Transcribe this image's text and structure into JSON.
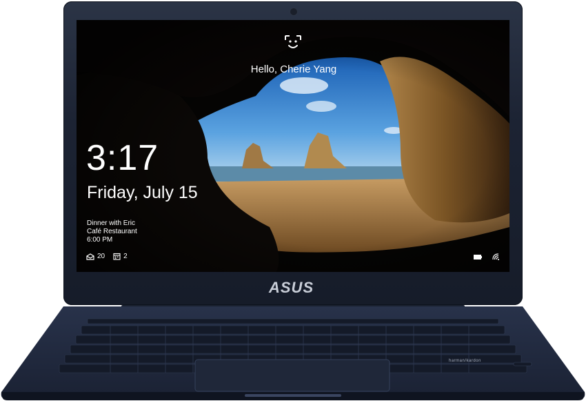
{
  "device": {
    "brand_logo": "ASUS",
    "speaker_brand": "harman/kardon"
  },
  "lock_screen": {
    "greeting": "Hello, Cherie Yang",
    "time": "3:17",
    "date": "Friday, July 15",
    "event": {
      "title": "Dinner with Eric",
      "location": "Café Restaurant",
      "time": "6:00 PM"
    },
    "badges": [
      {
        "icon": "mail-icon",
        "count": "20"
      },
      {
        "icon": "calendar-icon",
        "count": "2"
      }
    ],
    "status_icons": [
      "battery-icon",
      "wifi-icon"
    ]
  }
}
